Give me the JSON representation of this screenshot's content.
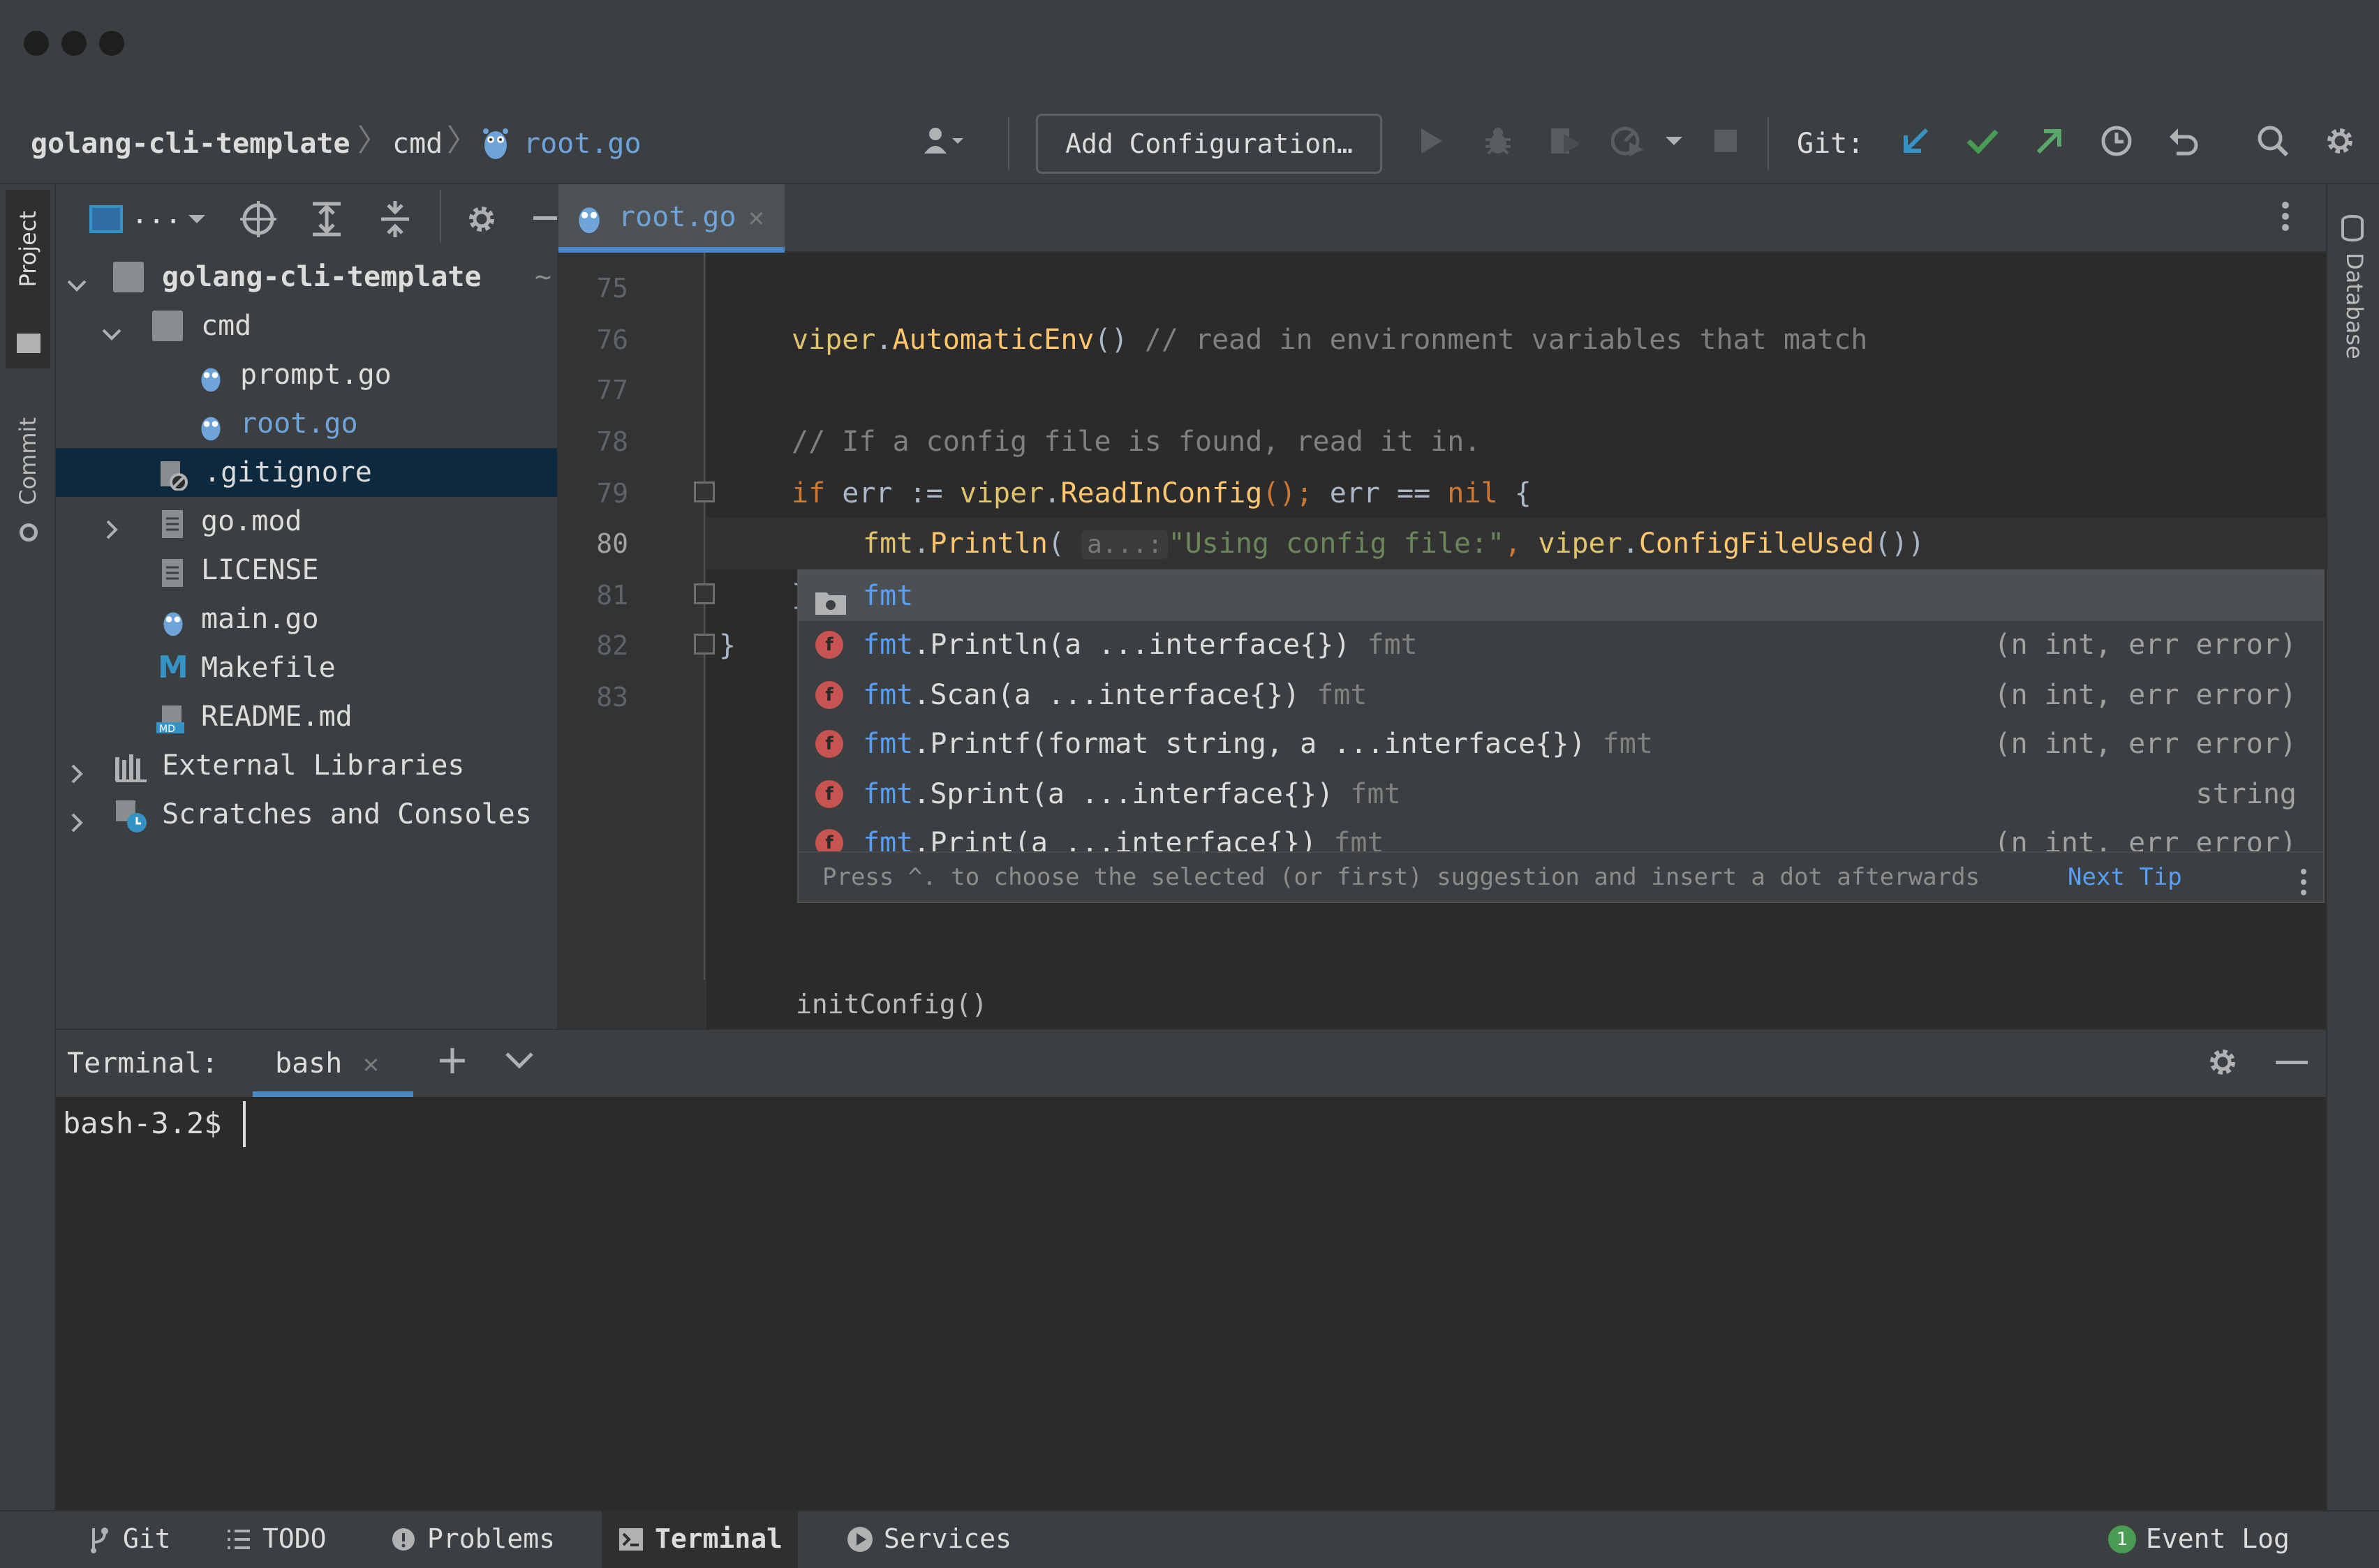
{
  "window": {
    "traffic_lights": [
      "close",
      "minimize",
      "zoom"
    ]
  },
  "breadcrumbs": {
    "project": "golang-cli-template",
    "folder": "cmd",
    "file": "root.go"
  },
  "toolbar": {
    "add_configuration": "Add Configuration…",
    "git_label": "Git:"
  },
  "left_stripe": {
    "project_tab": "Project",
    "commit_tab": "Commit"
  },
  "right_stripe": {
    "database_tab": "Database"
  },
  "project_tree": {
    "toolbar_view": "...",
    "rows": [
      {
        "label": "golang-cli-template",
        "suffix": "~",
        "type": "folder",
        "expanded": true
      },
      {
        "label": "cmd",
        "type": "folder",
        "expanded": true
      },
      {
        "label": "prompt.go",
        "type": "go-file"
      },
      {
        "label": "root.go",
        "type": "go-file",
        "color": "#6ea4d9"
      },
      {
        "label": ".gitignore",
        "type": "ignore-file",
        "selected": true
      },
      {
        "label": "go.mod",
        "type": "mod-file",
        "expandable": true
      },
      {
        "label": "LICENSE",
        "type": "text-file"
      },
      {
        "label": "main.go",
        "type": "go-file"
      },
      {
        "label": "Makefile",
        "type": "makefile"
      },
      {
        "label": "README.md",
        "type": "markdown-file"
      },
      {
        "label": "External Libraries",
        "type": "library",
        "expandable": true
      },
      {
        "label": "Scratches and Consoles",
        "type": "scratches",
        "expandable": true
      }
    ]
  },
  "editor": {
    "tab": "root.go",
    "line_numbers": [
      "75",
      "76",
      "77",
      "78",
      "79",
      "80",
      "81",
      "82",
      "83"
    ],
    "current_line": "80",
    "code": {
      "l76_pkg": "viper",
      "l76_fn": "AutomaticEnv",
      "l76_call": "()",
      "l76_comment": "// read in environment variables that match",
      "l78_comment": "// If a config file is found, read it in.",
      "l79_if": "if",
      "l79_err": "err :=",
      "l79_pkg": "viper",
      "l79_fn": "ReadInConfig",
      "l79_semicolon": "();",
      "l79_cond": "err ==",
      "l79_nil": "nil",
      "l79_brace": "{",
      "l80_pkg": "fmt",
      "l80_fn": "Println",
      "l80_paren": "(",
      "l80_hint": "a...:",
      "l80_str": "\"Using config file:\"",
      "l80_comma": ",",
      "l80_pkg2": "viper",
      "l80_fn2": "ConfigFileUsed",
      "l80_end": "())",
      "l81_brace": "}",
      "l82_brace": "}"
    },
    "breadcrumb": "initConfig()"
  },
  "completion": {
    "rows": [
      {
        "kind": "package",
        "match": "fmt",
        "rest": "",
        "pkg": "",
        "ret": ""
      },
      {
        "kind": "func",
        "match": "fmt",
        "rest": ".Println(a ...interface{})",
        "pkg": "fmt",
        "ret": "(n int, err error)"
      },
      {
        "kind": "func",
        "match": "fmt",
        "rest": ".Scan(a ...interface{})",
        "pkg": "fmt",
        "ret": "(n int, err error)"
      },
      {
        "kind": "func",
        "match": "fmt",
        "rest": ".Printf(format string, a ...interface{})",
        "pkg": "fmt",
        "ret": "(n int, err error)"
      },
      {
        "kind": "func",
        "match": "fmt",
        "rest": ".Sprint(a ...interface{})",
        "pkg": "fmt",
        "ret": "string"
      },
      {
        "kind": "func",
        "match": "fmt",
        "rest": ".Print(a ...interface{})",
        "pkg": "fmt",
        "ret": "(n int, err error)"
      }
    ],
    "func_badge": "f",
    "footer_text": "Press ^. to choose the selected (or first) suggestion and insert a dot afterwards",
    "next_tip": "Next Tip"
  },
  "terminal": {
    "title": "Terminal:",
    "tab": "bash",
    "prompt": "bash-3.2$"
  },
  "bottom_bar": {
    "git": "Git",
    "todo": "TODO",
    "problems": "Problems",
    "terminal": "Terminal",
    "services": "Services",
    "event_log": "Event Log",
    "event_count": "1"
  },
  "colors": {
    "accent": "#4a88c7",
    "selection": "#0d293e",
    "keyword": "#cc7832",
    "function": "#ffc66d",
    "string": "#6a8759",
    "comment": "#808080",
    "git_update": "#3592c4",
    "git_commit": "#499c54",
    "git_push": "#59a869"
  }
}
